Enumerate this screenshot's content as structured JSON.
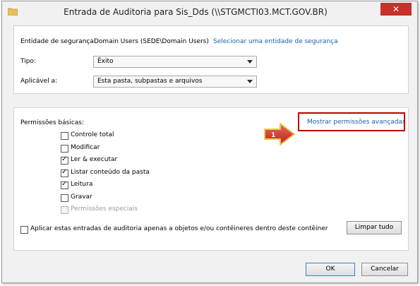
{
  "window": {
    "title": "Entrada de Auditoria para Sis_Dds (\\\\STGMCTI03.MCT.GOV.BR)",
    "close_label": "✕"
  },
  "top": {
    "security_entity_label": "Entidade de segurança:",
    "security_entity_value": "Domain Users (SEDE\\Domain Users)",
    "select_entity_link": "Selecionar uma entidade de segurança",
    "type_label": "Tipo:",
    "type_value": "Êxito",
    "applies_label": "Aplicável a:",
    "applies_value": "Esta pasta, subpastas e arquivos"
  },
  "permissions": {
    "basic_label": "Permissões básicas:",
    "advanced_link": "Mostrar permissões avançadas",
    "callout_number": "1",
    "items": [
      {
        "label": "Controle total",
        "checked": false,
        "disabled": false
      },
      {
        "label": "Modificar",
        "checked": false,
        "disabled": false
      },
      {
        "label": "Ler & executar",
        "checked": true,
        "disabled": false
      },
      {
        "label": "Listar conteúdo da pasta",
        "checked": true,
        "disabled": false
      },
      {
        "label": "Leitura",
        "checked": true,
        "disabled": false
      },
      {
        "label": "Gravar",
        "checked": false,
        "disabled": false
      },
      {
        "label": "Permissões especiais",
        "checked": false,
        "disabled": true
      }
    ],
    "apply_only_label": "Aplicar estas entradas de auditoria apenas a objetos e/ou contêineres dentro deste contêiner",
    "clear_all_label": "Limpar tudo"
  },
  "footer": {
    "ok_label": "OK",
    "cancel_label": "Cancelar"
  },
  "colors": {
    "link": "#1b5ea6",
    "highlight": "#c00000",
    "close": "#c7312a"
  }
}
